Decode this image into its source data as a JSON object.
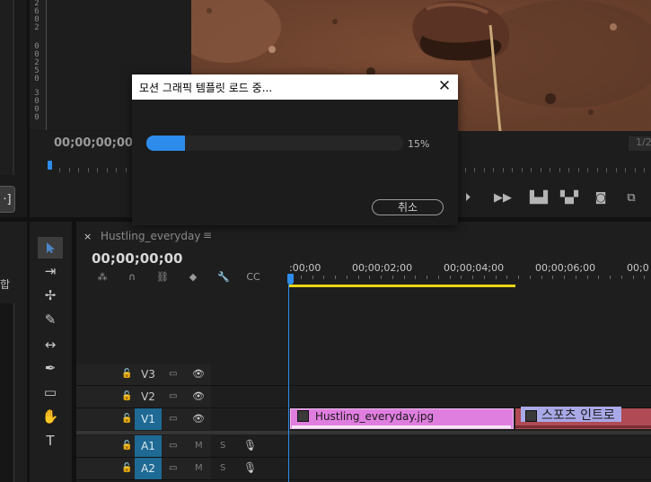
{
  "left_panel": {
    "button_label": "·]",
    "partial_text": "합"
  },
  "audio_meter": {
    "digits": [
      "2",
      "6",
      "0",
      "2",
      "0",
      "0",
      "2",
      "5",
      "0",
      "0",
      "3",
      "0",
      "0",
      "0"
    ]
  },
  "program_monitor": {
    "timecode": "00;00;00;00",
    "fraction": "1/2",
    "controls": [
      "step-forward-icon",
      "export-frame-icon",
      "insert-icon",
      "overwrite-icon",
      "camera-icon",
      "compare-icon"
    ]
  },
  "dialog": {
    "title": "모션 그래픽 템플릿 로드 중...",
    "close_label": "✕",
    "progress_percent": 15,
    "progress_text": "15%",
    "cancel_label": "취소"
  },
  "tools": [
    "selection-tool-icon",
    "track-select-tool-icon",
    "ripple-edit-tool-icon",
    "razor-tool-icon",
    "slip-tool-icon",
    "pen-tool-icon",
    "rectangle-tool-icon",
    "hand-tool-icon",
    "type-tool-icon"
  ],
  "timeline": {
    "close_label": "×",
    "sequence_name": "Hustling_everyday",
    "menu_label": "≡",
    "timecode": "00;00;00;00",
    "ruler_labels": [
      ":00;00",
      "00;00;02;00",
      "00;00;04;00",
      "00;00;06;00",
      "00;0"
    ],
    "tracks": {
      "v3": "V3",
      "v2": "V2",
      "v1": "V1",
      "a1": "A1",
      "a2": "A2"
    },
    "mute_label": "M",
    "solo_label": "S",
    "clips": {
      "v1_clip_a": "Hustling_everyday.jpg",
      "v1_clip_b": "스포츠 인트로"
    }
  },
  "colors": {
    "accent_blue": "#2d8ceb",
    "clip_pink": "#e07ee0",
    "clip_red": "#b04a54",
    "work_area_yellow": "#e8d414",
    "targeted_track": "#1e6a94"
  }
}
